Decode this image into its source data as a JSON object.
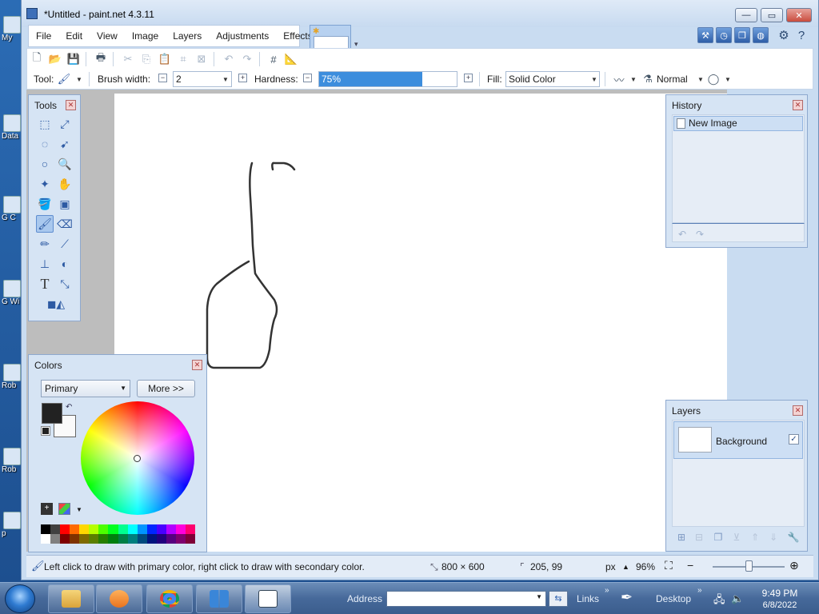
{
  "window": {
    "title": "*Untitled - paint.net 4.3.11",
    "min_glyph": "—",
    "max_glyph": "▭",
    "close_glyph": "✕"
  },
  "menu": [
    "File",
    "Edit",
    "View",
    "Image",
    "Layers",
    "Adjustments",
    "Effects"
  ],
  "toolbar": {
    "tool_label": "Tool:",
    "brush_width_label": "Brush width:",
    "brush_width_value": "2",
    "hardness_label": "Hardness:",
    "hardness_value": "75%",
    "hardness_fraction": 0.75,
    "fill_label": "Fill:",
    "fill_value": "Solid Color",
    "blend_mode": "Normal"
  },
  "tools_panel": {
    "title": "Tools",
    "active_tool": "paintbrush-tool",
    "text_tool_glyph": "T"
  },
  "history_panel": {
    "title": "History",
    "items": [
      "New Image"
    ]
  },
  "layers_panel": {
    "title": "Layers",
    "layers": [
      {
        "name": "Background",
        "visible": true
      }
    ]
  },
  "colors_panel": {
    "title": "Colors",
    "mode": "Primary",
    "more_button": "More >>",
    "primary_color": "#222222",
    "secondary_color": "#fafafa",
    "palette_row1": [
      "#000000",
      "#404040",
      "#ff0000",
      "#ff6a00",
      "#ffd800",
      "#b6ff00",
      "#4cff00",
      "#00ff21",
      "#00ff90",
      "#00ffff",
      "#0094ff",
      "#0026ff",
      "#4800ff",
      "#b200ff",
      "#ff00dc",
      "#ff006e"
    ],
    "palette_row2": [
      "#ffffff",
      "#808080",
      "#7f0000",
      "#7f3300",
      "#7f6a00",
      "#5b7f00",
      "#267f00",
      "#007f0e",
      "#007f46",
      "#007f7f",
      "#004a7f",
      "#00137f",
      "#21007f",
      "#57007f",
      "#7f006e",
      "#7f0037"
    ]
  },
  "status": {
    "hint": "Left click to draw with primary color, right click to draw with secondary color.",
    "image_size": "800 × 600",
    "cursor_pos": "205, 99",
    "units": "px",
    "zoom": "96%",
    "zoom_fraction": 0.5
  },
  "desktop_icons": [
    "My",
    "Data",
    "G C",
    "G Wi",
    "Rob",
    "Rob",
    "p"
  ],
  "taskbar": {
    "address_label": "Address",
    "links_label": "Links",
    "desktop_label": "Desktop",
    "time": "9:49 PM",
    "date": "6/8/2022"
  },
  "colors": {
    "accent": "#3d6fb8",
    "canvas": "#ffffff",
    "workspace": "#bdbdbd"
  }
}
